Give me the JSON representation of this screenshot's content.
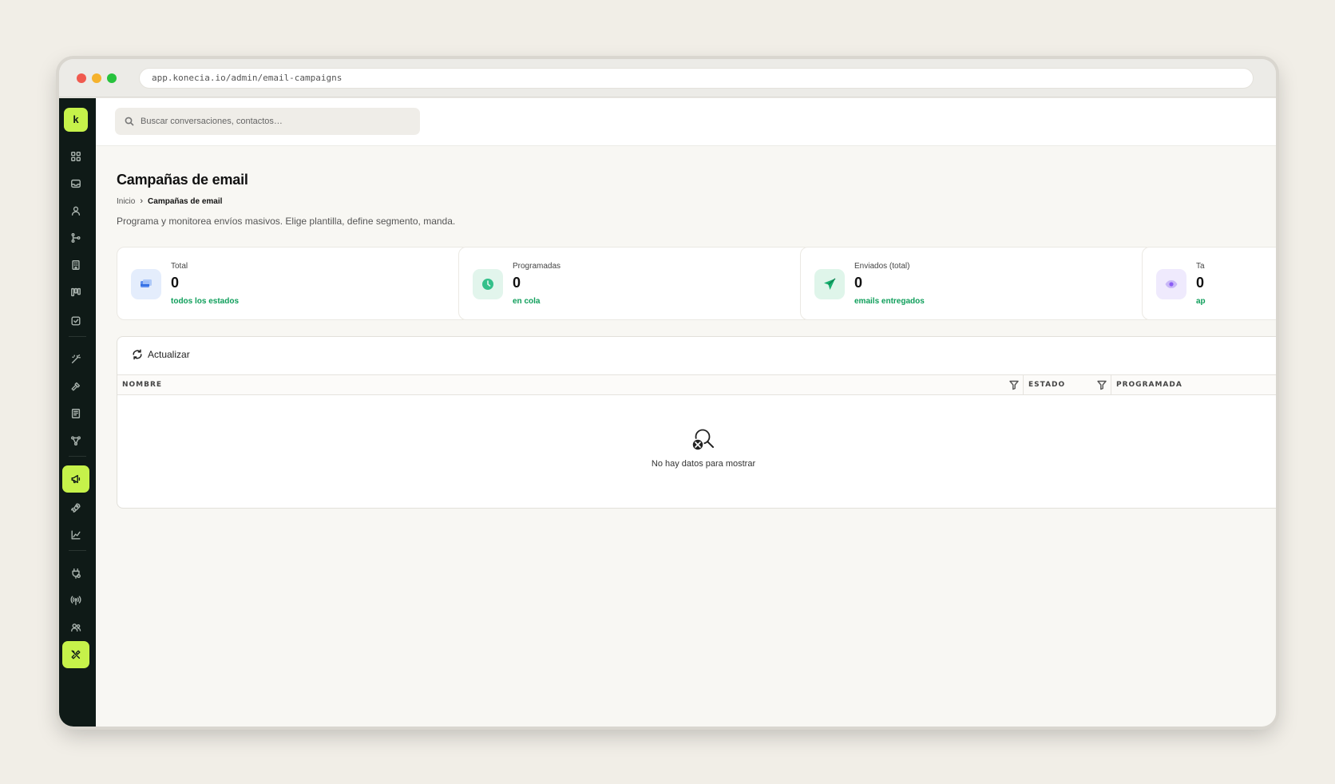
{
  "browser": {
    "url": "app.konecia.io/admin/email-campaigns"
  },
  "sidebar": {
    "logo_letter": "k",
    "items": [
      {
        "icon": "grid-icon"
      },
      {
        "icon": "inbox-icon"
      },
      {
        "icon": "user-icon"
      },
      {
        "icon": "branch-icon"
      },
      {
        "icon": "building-icon"
      },
      {
        "icon": "kanban-icon"
      },
      {
        "icon": "check-square-icon"
      },
      {
        "icon": "magic-wand-icon"
      },
      {
        "icon": "hammer-icon"
      },
      {
        "icon": "book-icon"
      },
      {
        "icon": "network-icon"
      },
      {
        "icon": "megaphone-icon",
        "active": true
      },
      {
        "icon": "rocket-icon"
      },
      {
        "icon": "line-chart-icon"
      },
      {
        "icon": "plug-icon"
      },
      {
        "icon": "broadcast-icon"
      },
      {
        "icon": "users-icon"
      },
      {
        "icon": "tools-icon",
        "active": true
      }
    ],
    "accent_color": "#c6f24a",
    "background_color": "#0f1a17"
  },
  "search": {
    "placeholder": "Buscar conversaciones, contactos…"
  },
  "page": {
    "title": "Campañas de email",
    "breadcrumb_home": "Inicio",
    "breadcrumb_current": "Campañas de email",
    "subtitle": "Programa y monitorea envíos masivos. Elige plantilla, define segmento, manda."
  },
  "stats": [
    {
      "label": "Total",
      "value": "0",
      "sub": "todos los estados",
      "icon": "campaign-icon",
      "color": "#3b82f6"
    },
    {
      "label": "Programadas",
      "value": "0",
      "sub": "en cola",
      "icon": "clock-icon",
      "color": "#10b981"
    },
    {
      "label": "Enviados (total)",
      "value": "0",
      "sub": "emails entregados",
      "icon": "send-icon",
      "color": "#10b981"
    },
    {
      "label": "Ta",
      "value": "0",
      "sub": "ap",
      "icon": "eye-icon",
      "color": "#8b5cf6"
    }
  ],
  "table": {
    "refresh_label": "Actualizar",
    "columns": [
      "NOMBRE",
      "ESTADO",
      "PROGRAMADA"
    ],
    "empty_text": "No hay datos para mostrar"
  }
}
